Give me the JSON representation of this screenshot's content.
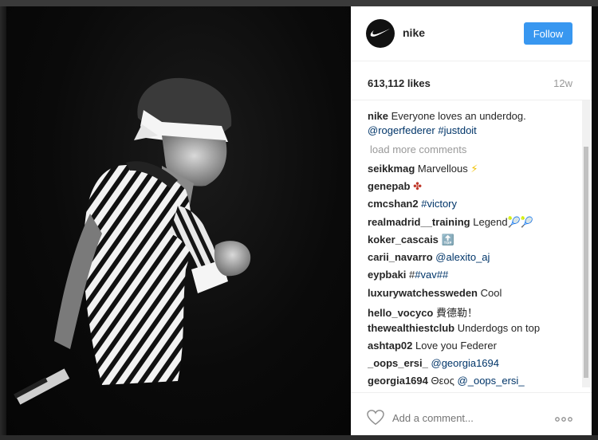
{
  "post": {
    "username": "nike",
    "follow_label": "Follow",
    "likes": "613,112 likes",
    "time": "12w"
  },
  "caption": {
    "user": "nike",
    "text": "Everyone loves an underdog.",
    "tag1": "@rogerfederer",
    "tag2": "#justdoit"
  },
  "load_more": "load more comments",
  "comments": [
    {
      "user": "seikkmag",
      "text": "Marvellous",
      "tag": "",
      "emoji": "⚡"
    },
    {
      "user": "genepab",
      "text": "",
      "tag": "",
      "emoji": "✤"
    },
    {
      "user": "cmcshan2",
      "text": "",
      "tag": "#victory",
      "emoji": ""
    },
    {
      "user": "realmadrid__training",
      "text": "Legend",
      "tag": "",
      "emoji": "🎾🎾"
    },
    {
      "user": "koker_cascais",
      "text": "",
      "tag": "",
      "emoji": "🔝"
    },
    {
      "user": "carii_navarro",
      "text": "",
      "tag": "@alexito_aj",
      "emoji": ""
    },
    {
      "user": "eypbaki",
      "text": "#",
      "tag": "#vav##",
      "emoji": ""
    },
    {
      "user": "luxurywatchessweden",
      "text": "Cool",
      "tag": "",
      "emoji": ""
    },
    {
      "user": "hello_vocyco",
      "text": "費德勒！",
      "tag": "",
      "emoji": ""
    },
    {
      "user": "thewealthiestclub",
      "text": "Underdogs on top",
      "tag": "",
      "emoji": ""
    },
    {
      "user": "ashtap02",
      "text": "Love you Federer",
      "tag": "",
      "emoji": ""
    },
    {
      "user": "_oops_ersi_",
      "text": "",
      "tag": "@georgia1694",
      "emoji": ""
    },
    {
      "user": "georgia1694",
      "text": "Θεος",
      "tag": "@_oops_ersi_",
      "emoji": ""
    }
  ],
  "add_comment_placeholder": "Add a comment...",
  "icons": {
    "avatar": "nike-swoosh-icon",
    "heart": "heart-icon",
    "more": "more-options-icon"
  },
  "colors": {
    "accent": "#3897f0",
    "tag": "#003569",
    "muted": "#999999"
  }
}
